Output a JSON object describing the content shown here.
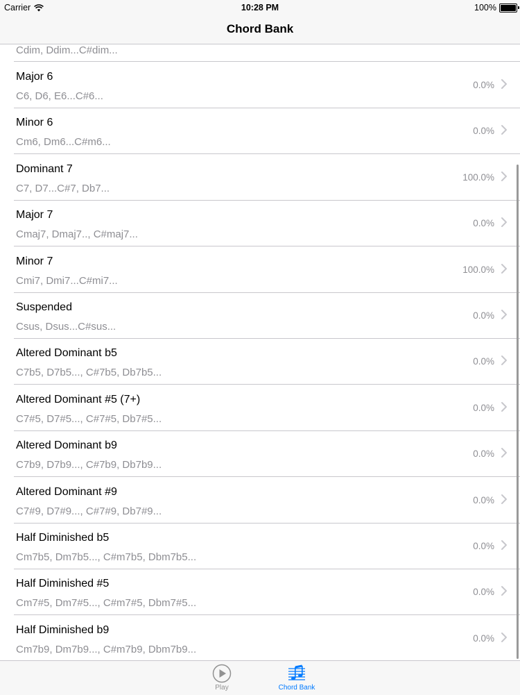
{
  "status_bar": {
    "carrier": "Carrier",
    "time": "10:28 PM",
    "battery": "100%"
  },
  "nav": {
    "title": "Chord Bank"
  },
  "partial_row": {
    "subtitle": "Cdim, Ddim...C#dim..."
  },
  "rows": [
    {
      "title": "Major 6",
      "subtitle": "C6, D6, E6...C#6...",
      "percent": "0.0%"
    },
    {
      "title": "Minor 6",
      "subtitle": "Cm6, Dm6...C#m6...",
      "percent": "0.0%"
    },
    {
      "title": "Dominant 7",
      "subtitle": "C7, D7...C#7, Db7...",
      "percent": "100.0%"
    },
    {
      "title": "Major 7",
      "subtitle": "Cmaj7, Dmaj7.., C#maj7...",
      "percent": "0.0%"
    },
    {
      "title": "Minor 7",
      "subtitle": "Cmi7, Dmi7...C#mi7...",
      "percent": "100.0%"
    },
    {
      "title": "Suspended",
      "subtitle": "Csus, Dsus...C#sus...",
      "percent": "0.0%"
    },
    {
      "title": "Altered Dominant b5",
      "subtitle": "C7b5, D7b5..., C#7b5, Db7b5...",
      "percent": "0.0%"
    },
    {
      "title": "Altered Dominant #5 (7+)",
      "subtitle": "C7#5, D7#5..., C#7#5, Db7#5...",
      "percent": "0.0%"
    },
    {
      "title": "Altered Dominant b9",
      "subtitle": "C7b9, D7b9..., C#7b9, Db7b9...",
      "percent": "0.0%"
    },
    {
      "title": "Altered Dominant #9",
      "subtitle": "C7#9, D7#9..., C#7#9, Db7#9...",
      "percent": "0.0%"
    },
    {
      "title": "Half Diminished b5",
      "subtitle": "Cm7b5, Dm7b5..., C#m7b5, Dbm7b5...",
      "percent": "0.0%"
    },
    {
      "title": "Half Diminished #5",
      "subtitle": "Cm7#5, Dm7#5..., C#m7#5, Dbm7#5...",
      "percent": "0.0%"
    },
    {
      "title": "Half Diminished b9",
      "subtitle": "Cm7b9, Dm7b9..., C#m7b9, Dbm7b9...",
      "percent": "0.0%"
    }
  ],
  "tabs": [
    {
      "label": "Play",
      "icon": "play-circle-icon",
      "selected": false
    },
    {
      "label": "Chord Bank",
      "icon": "music-staff-icon",
      "selected": true
    }
  ],
  "colors": {
    "accent": "#007aff",
    "secondary_text": "#8e8e93",
    "separator": "#c8c7cc",
    "bar_background": "#f7f7f7"
  }
}
